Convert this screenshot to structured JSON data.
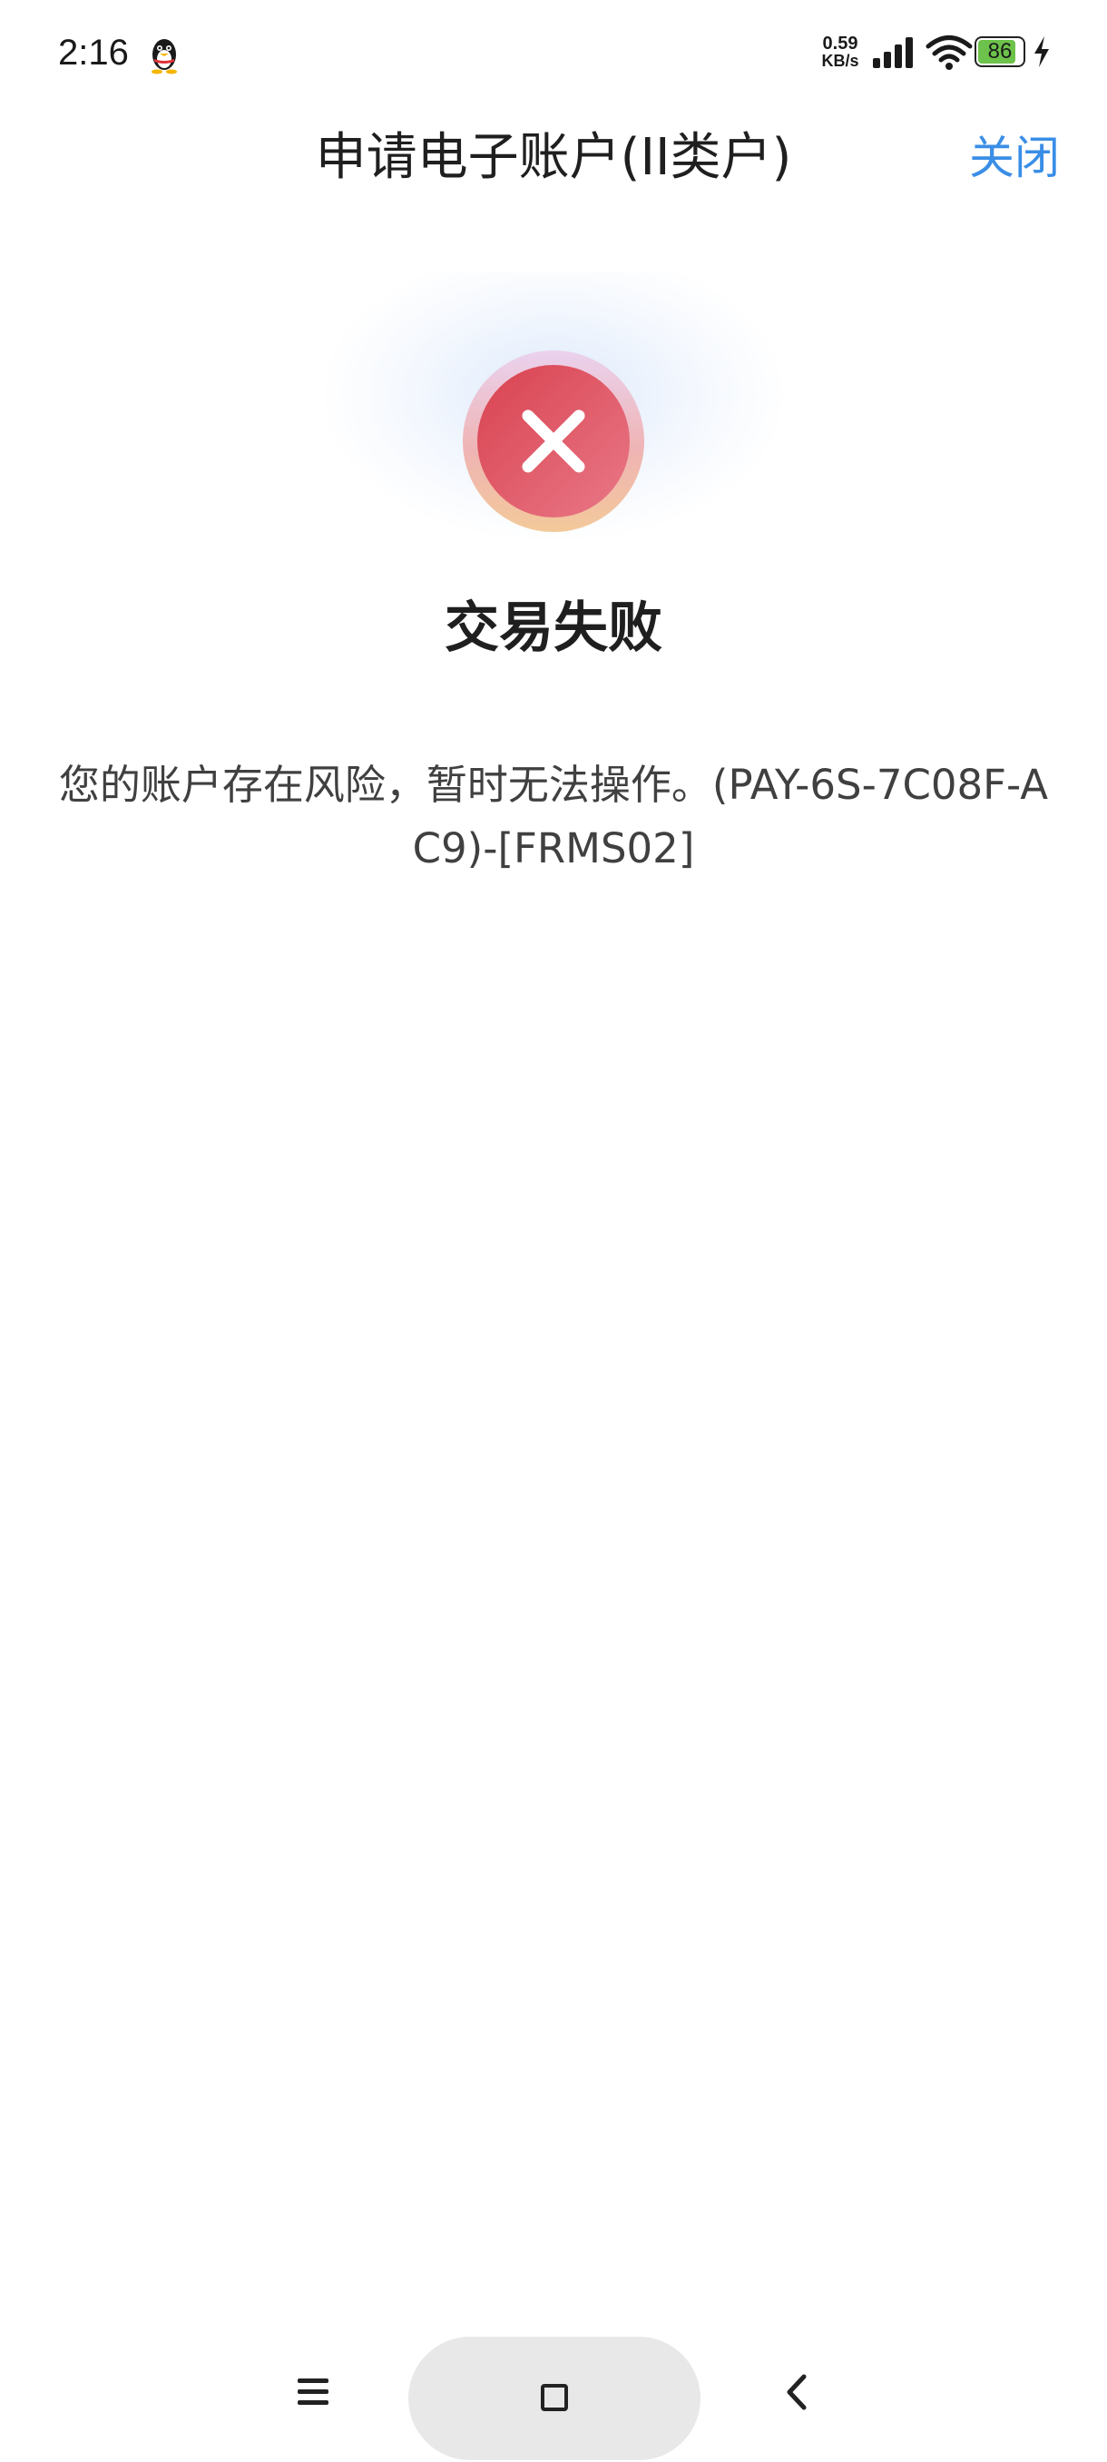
{
  "status_bar": {
    "time": "2:16",
    "net_speed_value": "0.59",
    "net_speed_unit": "KB/s",
    "battery_level": "86",
    "battery_percent": 86,
    "icons": [
      "qq-penguin-icon",
      "signal-icon",
      "wifi-icon",
      "battery-icon",
      "charging-icon"
    ]
  },
  "header": {
    "title": "申请电子账户(II类户)",
    "close_label": "关闭"
  },
  "result": {
    "status_icon": "error-x-icon",
    "title": "交易失败",
    "message": "您的账户存在风险，暂时无法操作。(PAY-6S-7C08F-AC9)-[FRMS02]"
  },
  "nav_bar": {
    "icons": [
      "menu-icon",
      "home-icon",
      "back-icon"
    ]
  },
  "colors": {
    "accent": "#3a8ee6",
    "error": "#e0505c",
    "battery": "#6cc24a"
  }
}
